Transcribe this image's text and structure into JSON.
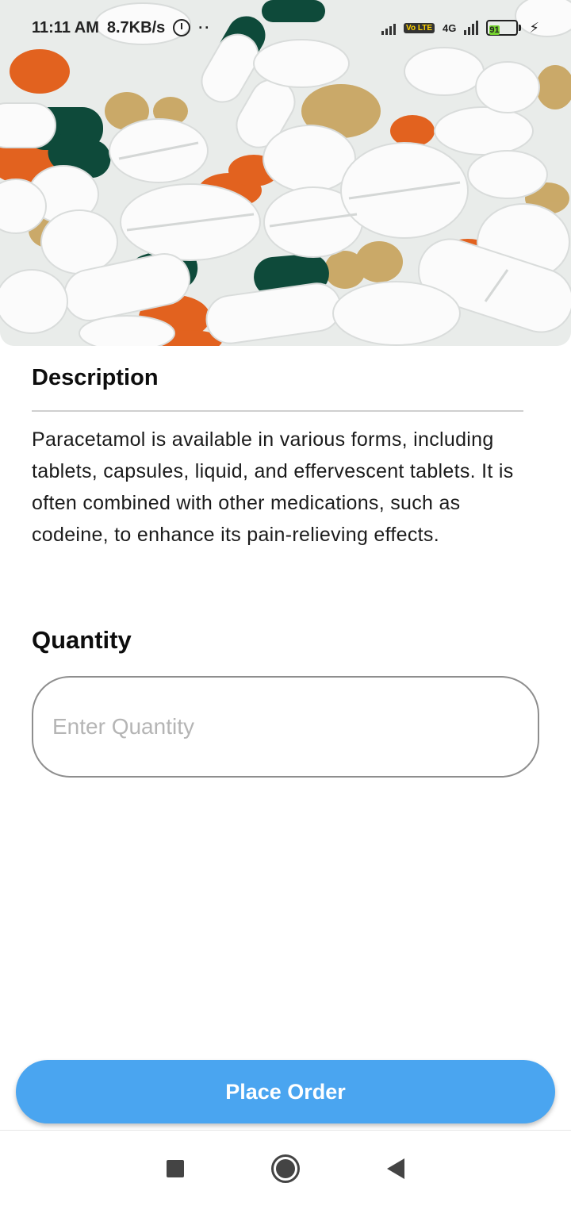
{
  "status_bar": {
    "time": "11:11 AM",
    "speed": "8.7KB/s",
    "volte": "Vo LTE",
    "network": "4G",
    "battery": "91",
    "icons": [
      "alarm-icon",
      "signal-icon",
      "battery-icon",
      "charging-icon"
    ]
  },
  "hero": {
    "image": "pills-capsules-photo"
  },
  "description": {
    "title": "Description",
    "text": "Paracetamol is available in various forms, including tablets, capsules, liquid, and effervescent tablets. It is often combined with other medications, such as codeine, to enhance its pain-relieving effects."
  },
  "quantity": {
    "title": "Quantity",
    "value": "",
    "placeholder": "Enter Quantity"
  },
  "actions": {
    "place_order": "Place Order"
  },
  "colors": {
    "primary": "#4aa5f0",
    "divider": "#cfcfcf",
    "input_border": "#8e8e8e"
  }
}
